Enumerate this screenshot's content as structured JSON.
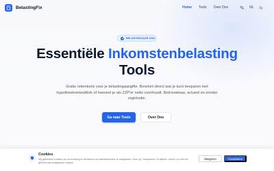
{
  "nav": {
    "brand": "BelastingFix",
    "links": [
      {
        "label": "Home",
        "active": true
      },
      {
        "label": "Tools",
        "active": false
      },
      {
        "label": "Over Ons",
        "active": false
      }
    ],
    "language": "NL",
    "translate_icon": "translate-icon",
    "theme_icon": "moon-icon"
  },
  "hero": {
    "badge": "BELASTINGJAAR 2026",
    "title_plain": "Essentiële",
    "title_accent": "Inkomstenbelasting",
    "title_second_line": "Tools",
    "description": "Gratis rekentools voor je belastingaangifte. Bereken direct wat je kunt besparen met hypotheekrenteaftrek of hoeveel je als ZZP'er netto overhoudt. Betrouwbaar, actueel en zonder registratie.",
    "primary_button": "Ga naar Tools",
    "secondary_button": "Over Ons"
  },
  "cookie": {
    "title": "Cookies",
    "text": "Wij gebruiken cookies om uw ervaring te verbeteren en websiteverkeer te analyseren. Door op \"Accepteren\" te klikken, stemt u in met het gebruik van analytische cookies.",
    "refuse_label": "Weigeren",
    "accept_label": "Accepteren"
  },
  "colors": {
    "accent": "#2563eb",
    "text": "#0f172a",
    "muted": "#4b5563"
  }
}
